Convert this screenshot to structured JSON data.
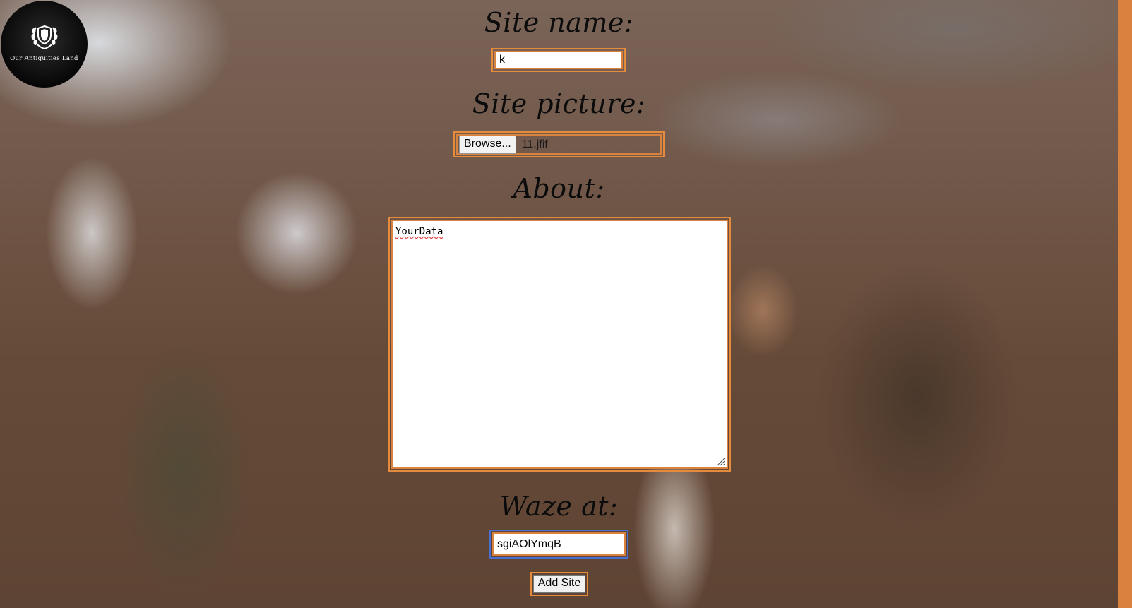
{
  "logo": {
    "text": "Our Antiquities Land",
    "icon": "laurel-shield-emblem"
  },
  "form": {
    "site_name": {
      "label": "Site name:",
      "value": "k"
    },
    "site_picture": {
      "label": "Site picture:",
      "browse_label": "Browse...",
      "file_name": "11.jfif"
    },
    "about": {
      "label": "About:",
      "value": "YourData"
    },
    "waze": {
      "label": "Waze at:",
      "value": "sgiAOlYmqB"
    },
    "submit_label": "Add Site"
  },
  "colors": {
    "accent": "#e68a3c",
    "right_bar": "#d9823f",
    "focus": "#4a6fd1"
  }
}
